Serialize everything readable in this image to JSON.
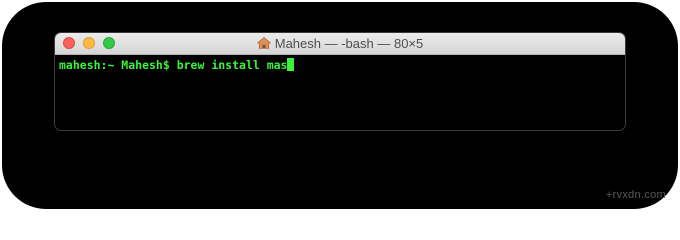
{
  "window": {
    "title": "Mahesh — -bash — 80×5",
    "title_icon": "home-icon"
  },
  "terminal": {
    "prompt": "mahesh:~ Mahesh$ ",
    "command": "brew install mas",
    "text_color": "#3cf23c",
    "background_color": "#000000"
  },
  "watermark": {
    "text": "+rvxdn.com"
  }
}
